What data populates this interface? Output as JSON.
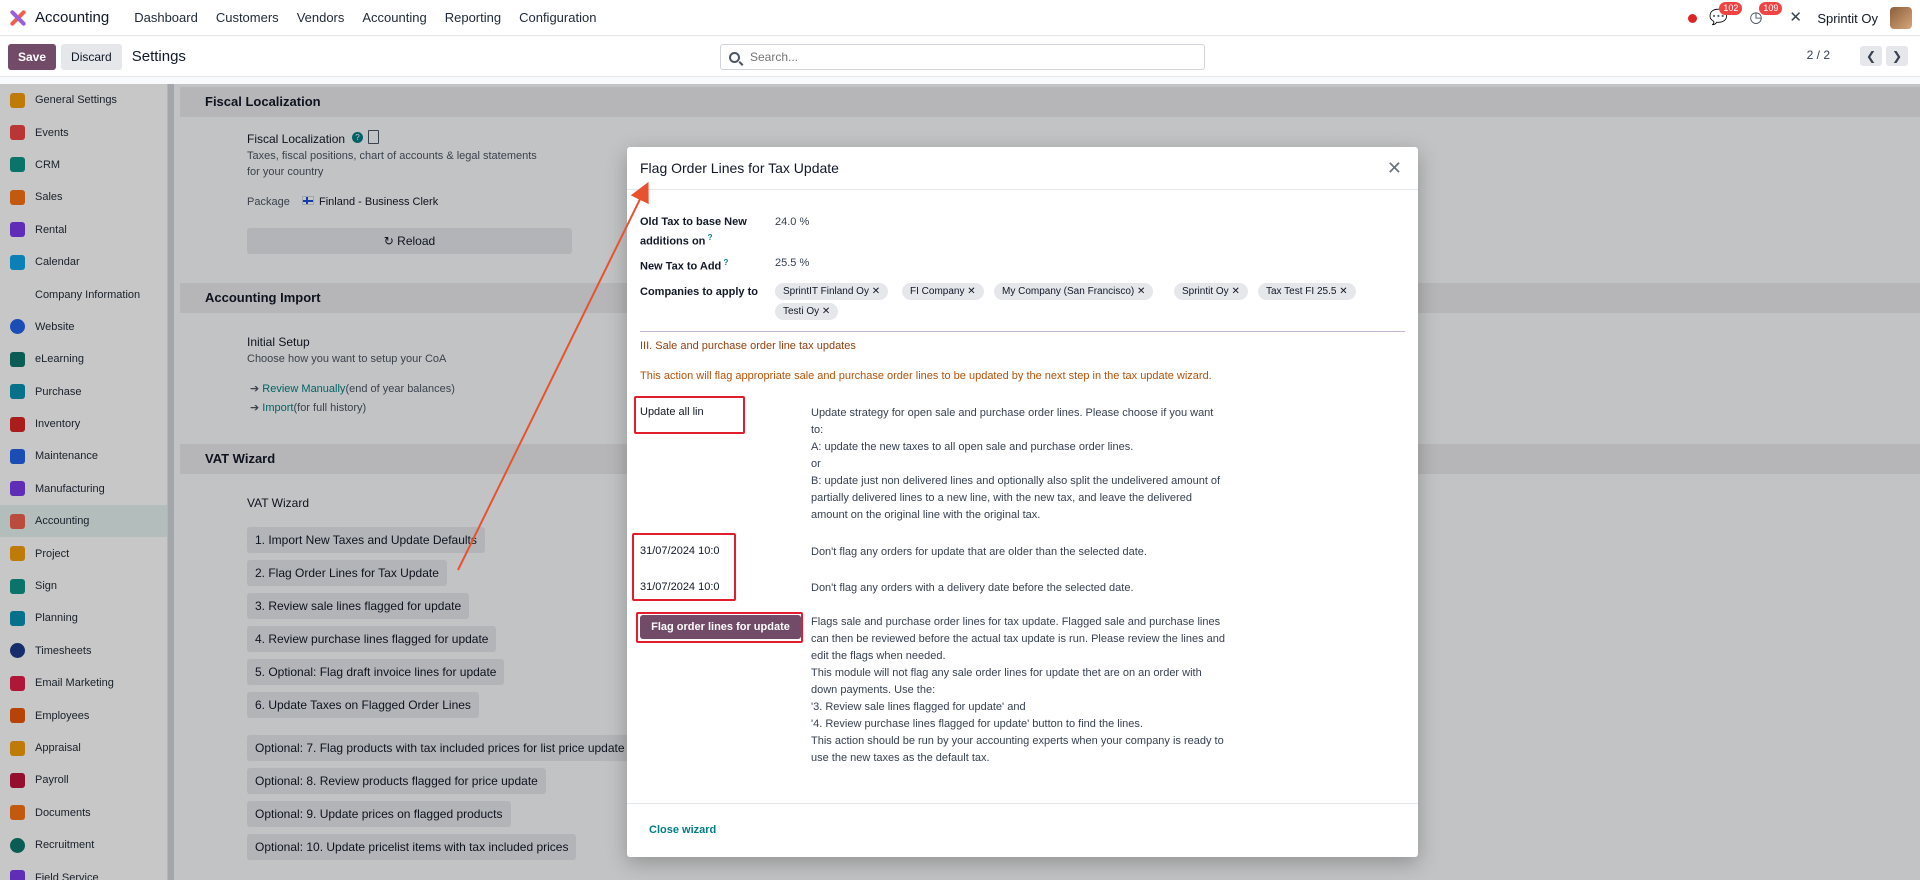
{
  "topbar": {
    "app_name": "Accounting",
    "menu": [
      "Dashboard",
      "Customers",
      "Vendors",
      "Accounting",
      "Reporting",
      "Configuration"
    ],
    "messages_count": "102",
    "activities_count": "109",
    "company": "Sprintit Oy"
  },
  "controlbar": {
    "save": "Save",
    "discard": "Discard",
    "title": "Settings",
    "search_placeholder": "Search...",
    "pager": "2 / 2"
  },
  "sidebar": {
    "items": [
      {
        "label": "General Settings",
        "color": "#f59e0b"
      },
      {
        "label": "Events",
        "color": "#ef4444"
      },
      {
        "label": "CRM",
        "color": "#0d9488"
      },
      {
        "label": "Sales",
        "color": "#f97316"
      },
      {
        "label": "Rental",
        "color": "#7c3aed"
      },
      {
        "label": "Calendar",
        "color": "#0ea5e9"
      },
      {
        "label": "Company Information",
        "color": "#ffffff"
      },
      {
        "label": "Website",
        "color": "#2563eb"
      },
      {
        "label": "eLearning",
        "color": "#0f766e"
      },
      {
        "label": "Purchase",
        "color": "#0891b2"
      },
      {
        "label": "Inventory",
        "color": "#dc2626"
      },
      {
        "label": "Maintenance",
        "color": "#2563eb"
      },
      {
        "label": "Manufacturing",
        "color": "#7c3aed"
      },
      {
        "label": "Accounting",
        "color": "#f06050"
      },
      {
        "label": "Project",
        "color": "#f59e0b"
      },
      {
        "label": "Sign",
        "color": "#0d9488"
      },
      {
        "label": "Planning",
        "color": "#0891b2"
      },
      {
        "label": "Timesheets",
        "color": "#1e3a8a"
      },
      {
        "label": "Email Marketing",
        "color": "#e11d48"
      },
      {
        "label": "Employees",
        "color": "#ea580c"
      },
      {
        "label": "Appraisal",
        "color": "#f59e0b"
      },
      {
        "label": "Payroll",
        "color": "#be123c"
      },
      {
        "label": "Documents",
        "color": "#f97316"
      },
      {
        "label": "Recruitment",
        "color": "#0f766e"
      },
      {
        "label": "Field Service",
        "color": "#7c3aed"
      }
    ],
    "active_index": 13
  },
  "settings": {
    "fiscal": {
      "header": "Fiscal Localization",
      "title": "Fiscal Localization",
      "desc_line1": "Taxes, fiscal positions, chart of accounts & legal statements",
      "desc_line2": "for your country",
      "package_label": "Package",
      "package_value": "Finland - Business Clerk",
      "reload": "Reload"
    },
    "import": {
      "header": "Accounting Import",
      "title": "Initial Setup",
      "desc": "Choose how you want to setup your CoA",
      "link1": "Review Manually",
      "link1_note": "(end of year balances)",
      "link2": "Import",
      "link2_note": "(for full history)"
    },
    "vat": {
      "header": "VAT Wizard",
      "title": "VAT Wizard",
      "buttons": [
        "1. Import New Taxes and Update Defaults",
        "2. Flag Order Lines for Tax Update",
        "3. Review sale lines flagged for update",
        "4. Review purchase lines flagged for update",
        "5. Optional: Flag draft invoice lines for update",
        "6. Update Taxes on Flagged Order Lines",
        "Optional: 7. Flag products with tax included prices for list price update",
        "Optional: 8. Review products flagged for price update",
        "Optional: 9. Update prices on flagged products",
        "Optional: 10. Update pricelist items with tax included prices"
      ]
    }
  },
  "modal": {
    "title": "Flag Order Lines for Tax Update",
    "old_tax_label_1": "Old Tax to base New",
    "old_tax_label_2": "additions on",
    "old_tax_value": "24.0 %",
    "new_tax_label": "New Tax to Add",
    "new_tax_value": "25.5 %",
    "companies_label": "Companies to apply to",
    "companies": [
      "SprintIT Finland Oy",
      "FI Company",
      "My Company (San Francisco)",
      "Sprintit Oy",
      "Tax Test FI 25.5",
      "Testi Oy"
    ],
    "section": "III. Sale and purchase order line tax updates",
    "warning": "This action will flag appropriate sale and purchase order lines to be updated by the next step in the tax update wizard.",
    "strategy_value": "Update all lin",
    "strategy_help": [
      "Update strategy for open sale and purchase order lines. Please choose if you want",
      "to:",
      "A: update the new taxes to all open sale and purchase order lines.",
      "or",
      "B: update just non delivered lines and optionally also split the undelivered amount of",
      "partially delivered lines to a new line, with the new tax, and leave the delivered",
      "amount on the original line with the original tax."
    ],
    "date1": "31/07/2024 10:0",
    "date1_help": "Don't flag any orders for update that are older than the selected date.",
    "date2": "31/07/2024 10:0",
    "date2_help": "Don't flag any orders with a delivery date before the selected date.",
    "flag_button": "Flag order lines for update",
    "flag_help": [
      "Flags sale and purchase order lines for tax update. Flagged sale and purchase lines",
      "can then be reviewed before the actual tax update is run. Please review the lines and",
      "edit the flags when needed.",
      "This module will not flag any sale order lines for update thet are on an order with",
      "down payments. Use the:",
      "'3. Review sale lines flagged for update' and",
      "'4. Review purchase lines flagged for update' button to find the lines.",
      "This action should be run by your accounting experts when your company is ready to",
      "use the new taxes as the default tax."
    ],
    "close": "Close wizard"
  }
}
